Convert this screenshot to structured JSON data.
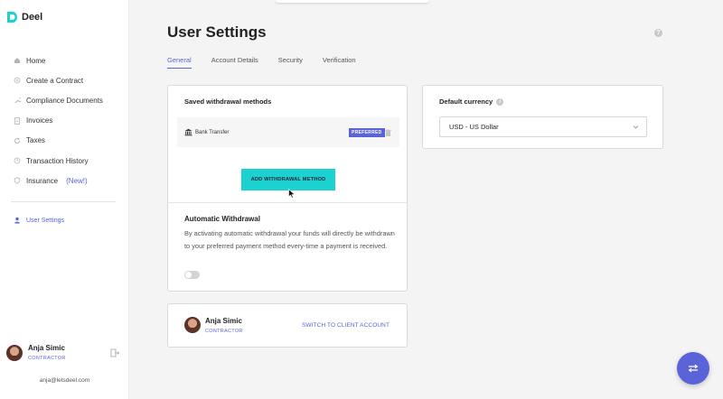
{
  "brand": {
    "name": "Deel",
    "accent": "#5a63d8",
    "teal": "#1ed1d1"
  },
  "sidebar": {
    "items": [
      {
        "label": "Home",
        "icon": "home-icon"
      },
      {
        "label": "Create a Contract",
        "icon": "plus-circle-icon"
      },
      {
        "label": "Compliance Documents",
        "icon": "wrench-icon"
      },
      {
        "label": "Invoices",
        "icon": "document-icon"
      },
      {
        "label": "Taxes",
        "icon": "refresh-icon"
      },
      {
        "label": "Transaction History",
        "icon": "clock-icon"
      },
      {
        "label": "Insurance",
        "icon": "shield-icon",
        "badge": "(New!)"
      }
    ],
    "user_settings": "User Settings",
    "user": {
      "name": "Anja Simic",
      "role": "CONTRACTOR",
      "email": "anja@letsdeel.com"
    }
  },
  "page": {
    "title": "User Settings",
    "tabs": [
      "General",
      "Account Details",
      "Security",
      "Verification"
    ],
    "active_tab": "General"
  },
  "withdrawal": {
    "title": "Saved withdrawal methods",
    "method": "Bank Transfer",
    "preferred_badge": "PREFERRED",
    "add_button": "ADD WITHDRAWAL METHOD",
    "auto_title": "Automatic Withdrawal",
    "auto_desc": "By activating automatic withdrawal your funds will directly be withdrawn to your preferred payment method every-time a payment is received.",
    "auto_enabled": false
  },
  "account": {
    "name": "Anja Simic",
    "role": "CONTRACTOR",
    "switch_link": "SWITCH TO CLIENT ACCOUNT"
  },
  "currency": {
    "label": "Default currency",
    "selected": "USD - US Dollar"
  },
  "help_glyph": "?",
  "info_glyph": "i"
}
